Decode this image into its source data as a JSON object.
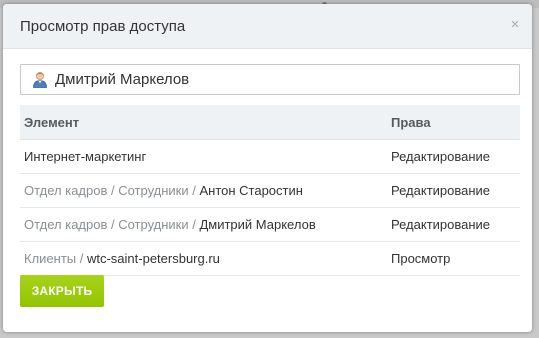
{
  "dialog": {
    "title": "Просмотр прав доступа",
    "close_icon": "×"
  },
  "user_field": {
    "icon": "user-icon",
    "name": "Дмитрий Маркелов"
  },
  "table": {
    "columns": [
      "Элемент",
      "Права"
    ],
    "rows": [
      {
        "path": "",
        "element": "Интернет-маркетинг",
        "rights": "Редактирование"
      },
      {
        "path": "Отдел кадров / Сотрудники / ",
        "element": "Антон Старостин",
        "rights": "Редактирование"
      },
      {
        "path": "Отдел кадров / Сотрудники / ",
        "element": "Дмитрий Маркелов",
        "rights": "Редактирование"
      },
      {
        "path": "Клиенты / ",
        "element": "wtc-saint-petersburg.ru",
        "rights": "Просмотр"
      }
    ]
  },
  "footer": {
    "close_label": "ЗАКРЫТЬ"
  },
  "colors": {
    "accent_button": "#9dcf00",
    "header_bg": "#eef2f4",
    "path_text": "#8a8f93"
  }
}
